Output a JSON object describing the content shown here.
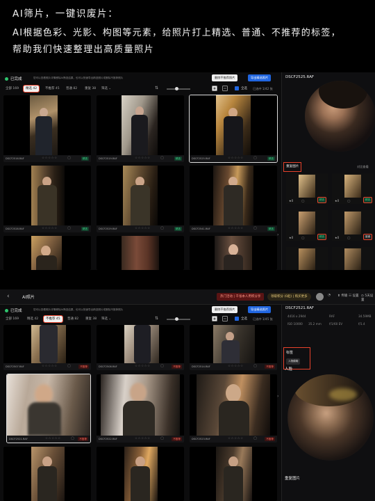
{
  "header": {
    "line1": "AI筛片，一键识废片：",
    "line2": "AI根据色彩、光影、构图等元素，给照片打上精选、普通、不推荐的标签，",
    "line3": "帮助我们快速整理出高质量照片"
  },
  "shot1": {
    "status": "已完成",
    "hint": "您可以查看照片详情移除AI筛选结果，也可以快速导出精选照片或删除不推荐照片",
    "delete_btn": "删除不推荐照片",
    "export_btn": "导出精选照片",
    "tabs": [
      "全部 169",
      "精选 42",
      "不推荐 45",
      "普通 82",
      "重复 38"
    ],
    "filter": "筛选",
    "select_all": "全选",
    "selected_count": "已选中 1/42 张",
    "cards": [
      {
        "file": "DSCF2516.RAF",
        "tag": "精选"
      },
      {
        "file": "DSCF2519.RAF",
        "tag": "精选"
      },
      {
        "file": "DSCF2525.RAF",
        "tag": "精选"
      },
      {
        "file": "DSCF2528.RAF",
        "tag": "精选"
      },
      {
        "file": "DSCF2529.RAF",
        "tag": "精选"
      },
      {
        "file": "DSCF2541.RAF",
        "tag": "精选"
      }
    ],
    "stars": "☆☆☆☆☆",
    "panel_file": "DSCF2525.RAF",
    "dup_title": "重复图片",
    "dup_compare": "对比查看",
    "dup_cards": [
      {
        "star": "★0",
        "tag": "精选"
      },
      {
        "star": "★0",
        "tag": "精选"
      },
      {
        "star": "★0",
        "tag": "精选"
      },
      {
        "star": "★0",
        "tag": "普通"
      }
    ]
  },
  "shot2": {
    "back": "‹",
    "app_title": "AI照片",
    "promo": "热门活动 | 千张本人用积分享",
    "lead_label": "领取积分 (0起) | 购买更多",
    "tb_items": [
      "⬆ 传输",
      "☷ 设置",
      "◷ 5天设置"
    ],
    "status": "已完成",
    "hint": "您可以查看照片详情移除AI筛选结果，也可以快速导出精选照片或删除不推荐照片",
    "delete_btn": "删除不推荐照片",
    "export_btn": "导出精选照片",
    "tabs": [
      "全部 169",
      "精选 42",
      "不推荐 45",
      "普通 82",
      "重复 38"
    ],
    "filter": "筛选",
    "select_all": "全选",
    "selected_count": "已选中 1/45 张",
    "cards": [
      {
        "file": "DSCF2507.RAF",
        "tag": "不推荐"
      },
      {
        "file": "DSCF2508.RAF",
        "tag": "不推荐"
      },
      {
        "file": "DSCF2514.RAF",
        "tag": "不推荐"
      },
      {
        "file": "DSCF2521.RAF",
        "tag": "不推荐"
      },
      {
        "file": "DSCF2522.RAF",
        "tag": "不推荐"
      },
      {
        "file": "DSCF2523.RAF",
        "tag": "不推荐"
      }
    ],
    "stars": "☆☆☆☆☆",
    "panel_file": "DSCF2521.RAF",
    "meta1": [
      "4416 x 2944",
      "RAF",
      "34.59MB"
    ],
    "meta2": [
      "ISO 10000",
      "35.2 mm",
      "f/1/60 EV",
      "f/1.4"
    ],
    "tags_title": "标签",
    "tag_chip": "人物模糊",
    "face_title": "人脸",
    "dup_title": "重复图片"
  },
  "colors": {
    "accent_blue": "#2166e0",
    "highlight_red": "#e8422b",
    "good_green": "#3fd58a",
    "bad_red": "#ff6a5a"
  }
}
